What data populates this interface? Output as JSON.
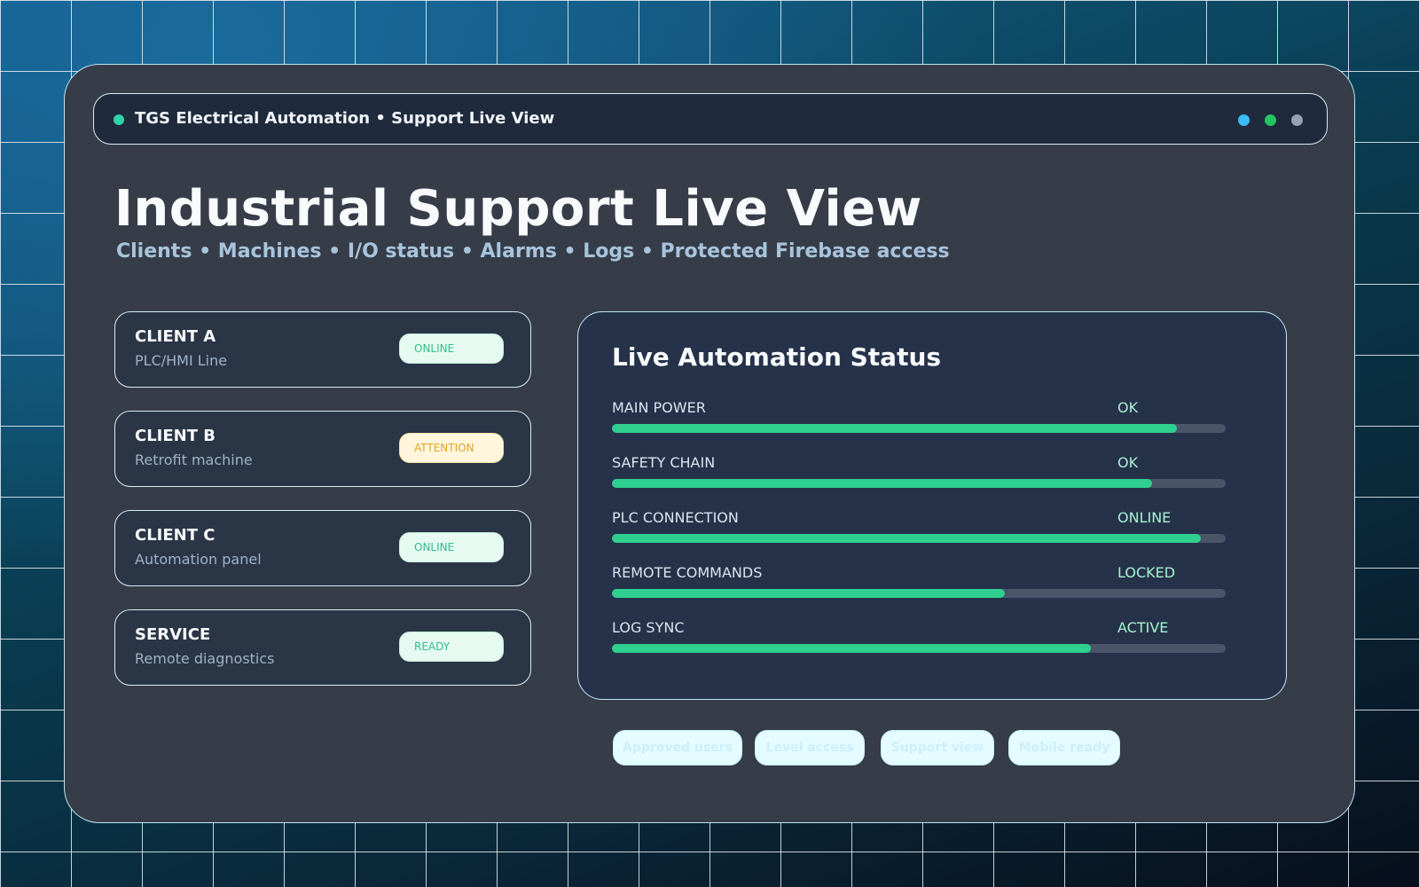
{
  "window": {
    "title": "TGS Electrical Automation • Support Live View",
    "status_dot_color": "#2dd4a7",
    "controls": [
      "blue-dot",
      "green-dot",
      "gray-dot"
    ]
  },
  "page": {
    "title": "Industrial Support Live View",
    "subtitle": "Clients • Machines • I/O status • Alarms • Logs • Protected Firebase access"
  },
  "clients": [
    {
      "name": "CLIENT A",
      "desc": "PLC/HMI Line",
      "status": "ONLINE",
      "tone": "green"
    },
    {
      "name": "CLIENT B",
      "desc": "Retrofit machine",
      "status": "ATTENTION",
      "tone": "amber"
    },
    {
      "name": "CLIENT C",
      "desc": "Automation panel",
      "status": "ONLINE",
      "tone": "green"
    },
    {
      "name": "SERVICE",
      "desc": "Remote diagnostics",
      "status": "READY",
      "tone": "green"
    }
  ],
  "live_status": {
    "title": "Live Automation Status",
    "rows": [
      {
        "label": "MAIN POWER",
        "value": "OK",
        "level": 0.92
      },
      {
        "label": "SAFETY CHAIN",
        "value": "OK",
        "level": 0.88
      },
      {
        "label": "PLC CONNECTION",
        "value": "ONLINE",
        "level": 0.96
      },
      {
        "label": "REMOTE COMMANDS",
        "value": "LOCKED",
        "level": 0.64
      },
      {
        "label": "LOG SYNC",
        "value": "ACTIVE",
        "level": 0.78
      }
    ]
  },
  "tags": [
    "Approved users",
    "Level access",
    "Support view",
    "Mobile ready"
  ],
  "colors": {
    "accent_green": "#2fd08f",
    "attention_amber": "#e0a52a",
    "panel_bg": "#363c48"
  }
}
